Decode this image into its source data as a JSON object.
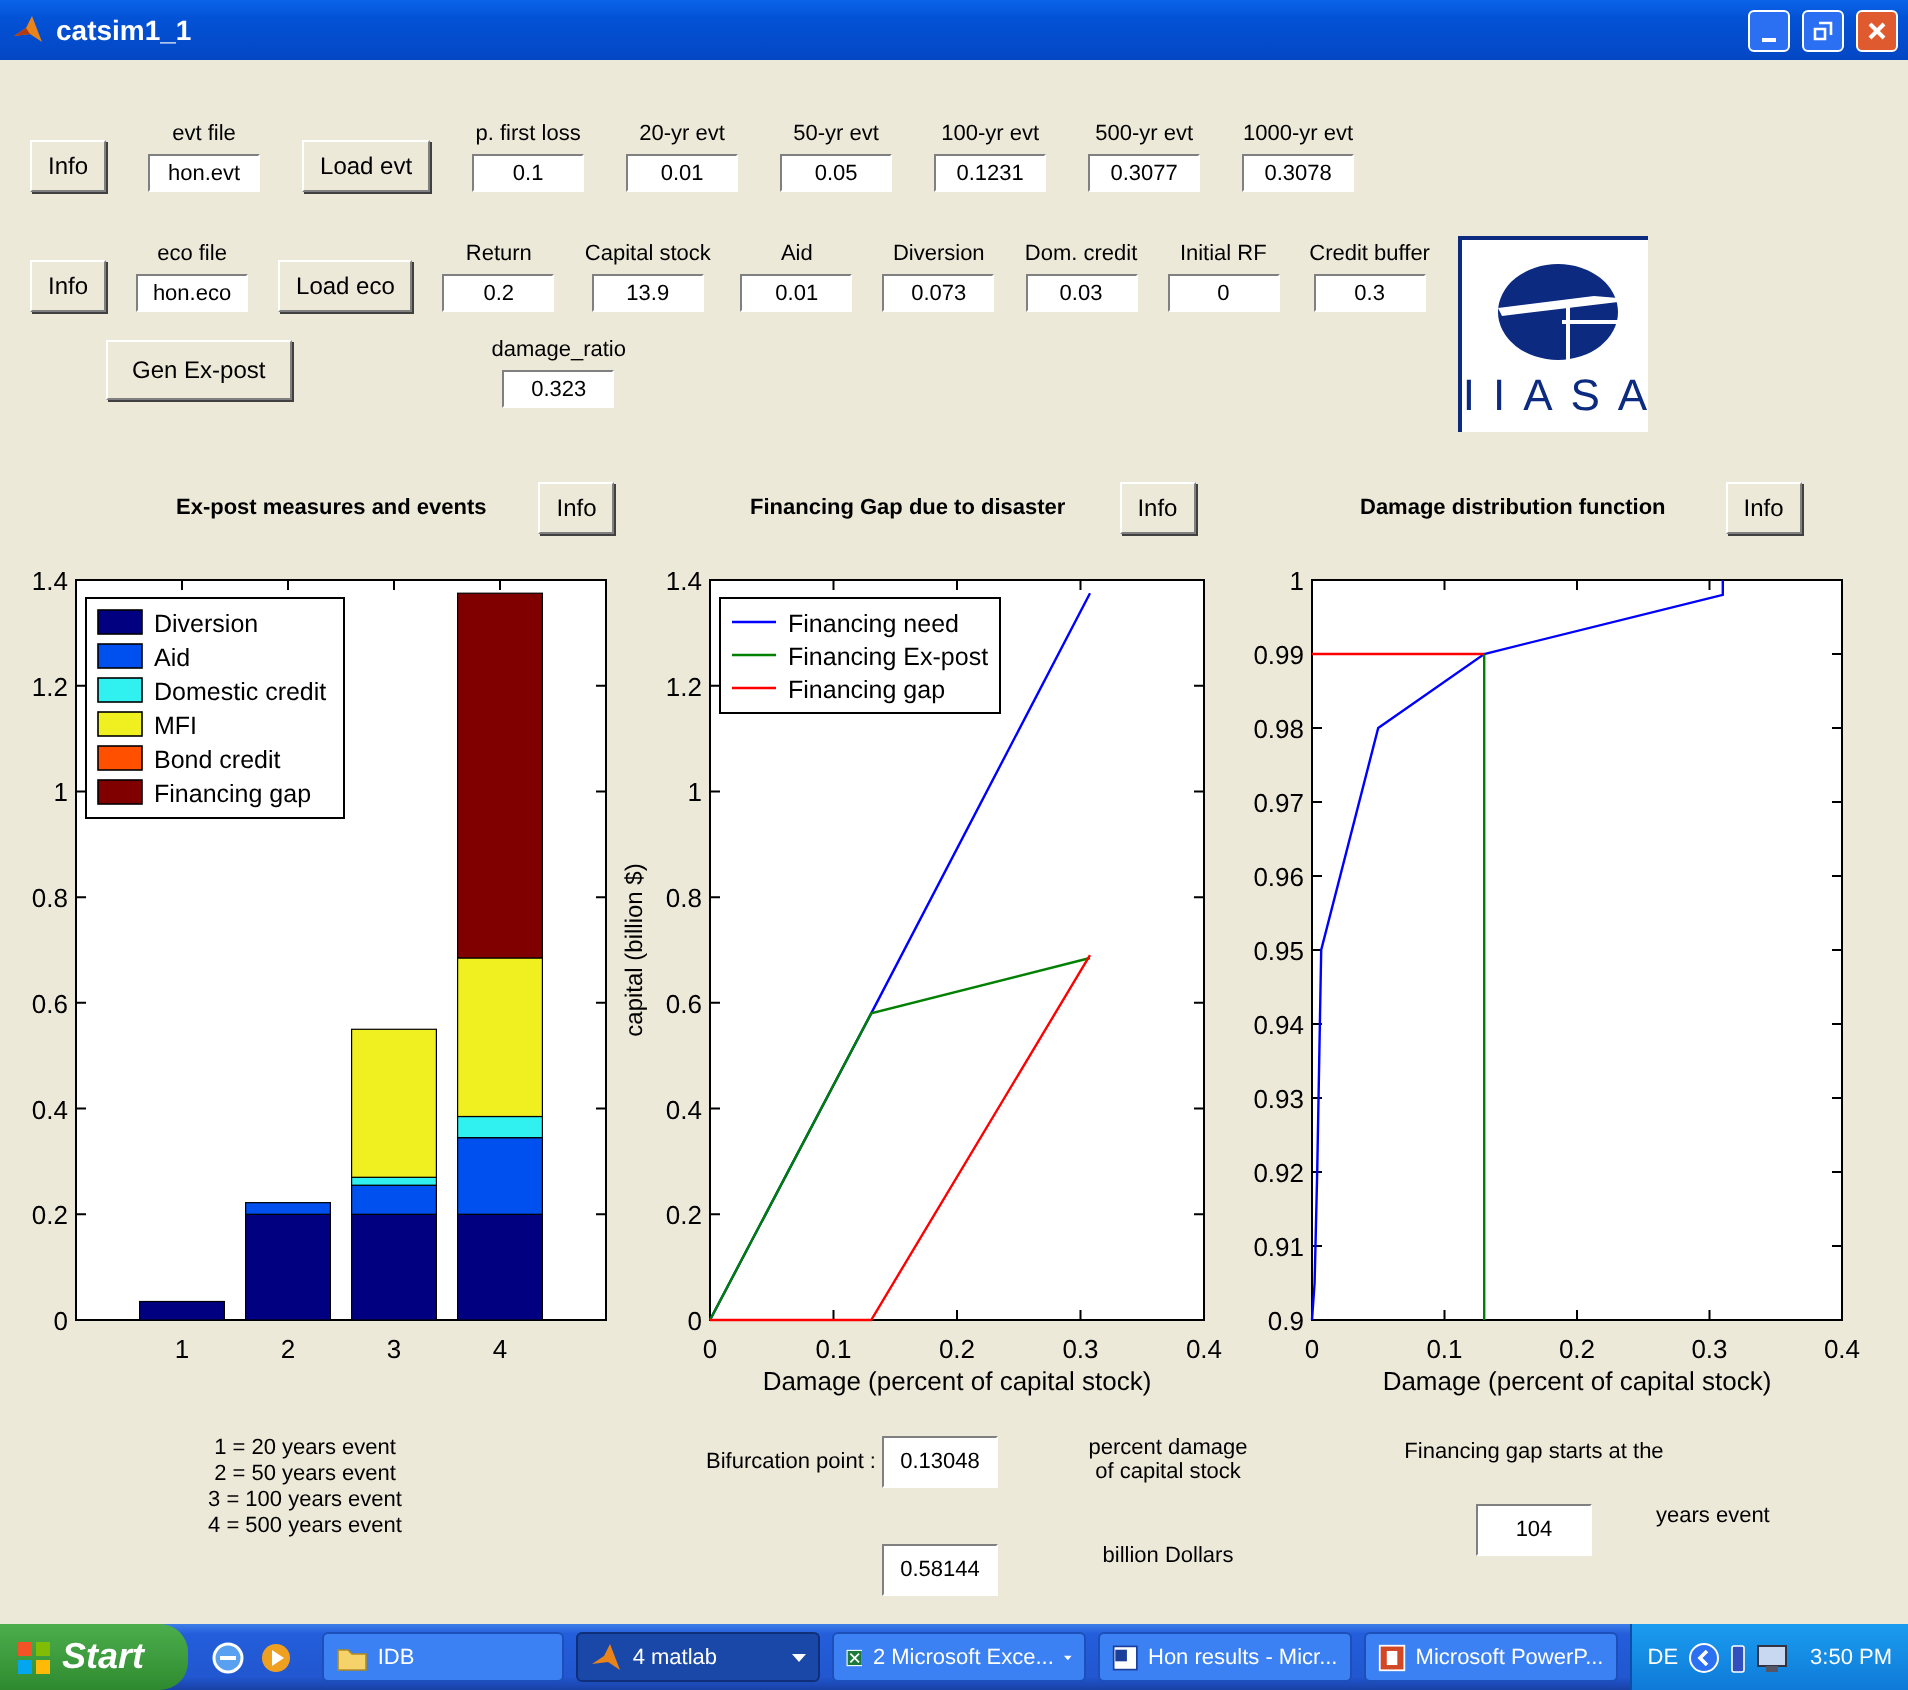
{
  "window": {
    "title": "catsim1_1"
  },
  "controls": [
    {
      "items": [
        {
          "kind": "button",
          "label": "Info"
        },
        {
          "kind": "field",
          "label": "evt file",
          "value": "hon.evt"
        },
        {
          "kind": "button",
          "label": "Load evt"
        },
        {
          "kind": "field",
          "label": "p. first loss",
          "value": "0.1"
        },
        {
          "kind": "field",
          "label": "20-yr evt",
          "value": "0.01"
        },
        {
          "kind": "field",
          "label": "50-yr evt",
          "value": "0.05"
        },
        {
          "kind": "field",
          "label": "100-yr evt",
          "value": "0.1231"
        },
        {
          "kind": "field",
          "label": "500-yr evt",
          "value": "0.3077"
        },
        {
          "kind": "field",
          "label": "1000-yr evt",
          "value": "0.3078"
        }
      ]
    },
    {
      "items": [
        {
          "kind": "button",
          "label": "Info"
        },
        {
          "kind": "field",
          "label": "eco file",
          "value": "hon.eco"
        },
        {
          "kind": "button",
          "label": "Load eco"
        },
        {
          "kind": "field",
          "label": "Return",
          "value": "0.2"
        },
        {
          "kind": "field",
          "label": "Capital stock",
          "value": "13.9"
        },
        {
          "kind": "field",
          "label": "Aid",
          "value": "0.01"
        },
        {
          "kind": "field",
          "label": "Diversion",
          "value": "0.073"
        },
        {
          "kind": "field",
          "label": "Dom. credit",
          "value": "0.03"
        },
        {
          "kind": "field",
          "label": "Initial RF",
          "value": "0"
        },
        {
          "kind": "field",
          "label": "Credit buffer",
          "value": "0.3"
        }
      ]
    },
    {
      "items": [
        {
          "kind": "button",
          "label": "Gen Ex-post"
        },
        {
          "kind": "field",
          "label": "damage_ratio",
          "value": "0.323"
        }
      ]
    }
  ],
  "logo": {
    "text": "IIASA"
  },
  "panels": [
    {
      "title": "Ex-post measures and events",
      "button": "Info",
      "chart_data": {
        "type": "bar",
        "stacked": true,
        "legend": "upper left",
        "categories": [
          "1",
          "2",
          "3",
          "4"
        ],
        "ylim": [
          0,
          1.4
        ],
        "yticks": [
          0,
          0.2,
          0.4,
          0.6,
          0.8,
          1,
          1.2,
          1.4
        ],
        "series": [
          {
            "name": "Diversion",
            "color": "#000080",
            "values": [
              0.035,
              0.2,
              0.2,
              0.2
            ]
          },
          {
            "name": "Aid",
            "color": "#0050f0",
            "values": [
              0,
              0.022,
              0.055,
              0.145
            ]
          },
          {
            "name": "Domestic credit",
            "color": "#30f0f0",
            "values": [
              0,
              0,
              0.015,
              0.04
            ]
          },
          {
            "name": "MFI",
            "color": "#f0f020",
            "values": [
              0,
              0,
              0.28,
              0.3
            ]
          },
          {
            "name": "Bond credit",
            "color": "#ff5000",
            "values": [
              0,
              0,
              0,
              0
            ]
          },
          {
            "name": "Financing gap",
            "color": "#800000",
            "values": [
              0,
              0,
              0,
              0.69
            ]
          }
        ]
      },
      "notes": [
        "1 = 20 years event",
        "2 = 50 years event",
        "3 = 100 years event",
        "4 = 500 years event"
      ]
    },
    {
      "title": "Financing Gap due to  disaster",
      "button": "Info",
      "chart_data": {
        "type": "line",
        "legend": "upper left",
        "xlabel": "Damage (percent of capital stock)",
        "ylabel": "capital (billion $)",
        "x": [
          0,
          0.13048,
          0.3077
        ],
        "xlim": [
          0,
          0.4
        ],
        "ylim": [
          0,
          1.4
        ],
        "xticks": [
          0,
          0.1,
          0.2,
          0.3,
          0.4
        ],
        "yticks": [
          0,
          0.2,
          0.4,
          0.6,
          0.8,
          1,
          1.2,
          1.4
        ],
        "series": [
          {
            "name": "Financing need",
            "color": "#0000ff",
            "values": [
              0,
              0.58,
              1.375
            ]
          },
          {
            "name": "Financing Ex-post",
            "color": "#008000",
            "values": [
              0,
              0.58,
              0.685
            ]
          },
          {
            "name": "Financing gap",
            "color": "#ff0000",
            "values": [
              0,
              0,
              0.69
            ]
          }
        ]
      },
      "outputs": [
        {
          "label": "Bifurcation point :",
          "value": "0.13048",
          "unit": "percent damage of capital stock"
        },
        {
          "value": "0.58144",
          "unit": "billion Dollars"
        }
      ]
    },
    {
      "title": "Damage distribution function",
      "button": "Info",
      "chart_data": {
        "type": "line",
        "xlabel": "Damage (percent of capital stock)",
        "xlim": [
          0,
          0.4
        ],
        "ylim": [
          0.9,
          1
        ],
        "xticks": [
          0,
          0.1,
          0.2,
          0.3,
          0.4
        ],
        "yticks": [
          0.9,
          0.91,
          0.92,
          0.93,
          0.94,
          0.95,
          0.96,
          0.97,
          0.98,
          0.99,
          1
        ],
        "series": [
          {
            "color": "#0000ff",
            "x": [
              0,
              0.002,
              0.004,
              0.007,
              0.05,
              0.13,
              0.31,
              0.31
            ],
            "values": [
              0.9,
              0.905,
              0.92,
              0.95,
              0.98,
              0.99,
              0.998,
              1
            ]
          },
          {
            "color": "#ff0000",
            "x": [
              0,
              0.13
            ],
            "values": [
              0.99,
              0.99
            ]
          },
          {
            "color": "#008000",
            "x": [
              0.13,
              0.13
            ],
            "values": [
              0.9,
              0.99
            ]
          }
        ]
      },
      "caption": "Financing gap starts at the",
      "outputs": [
        {
          "value": "104",
          "unit": "years event"
        }
      ]
    }
  ],
  "taskbar": {
    "start": "Start",
    "tasks": [
      {
        "kind": "folder",
        "label": "IDB",
        "selected": false,
        "group": false
      },
      {
        "kind": "matlab",
        "label": "4 matlab",
        "selected": true,
        "group": true
      },
      {
        "kind": "excel",
        "label": "2 Microsoft Exce...",
        "selected": false,
        "group": true
      },
      {
        "kind": "word",
        "label": "Hon results - Micr...",
        "selected": false,
        "group": false
      },
      {
        "kind": "powerpoint",
        "label": "Microsoft PowerP...",
        "selected": false,
        "group": false
      }
    ],
    "tray": {
      "language": "DE",
      "time": "3:50 PM"
    }
  }
}
